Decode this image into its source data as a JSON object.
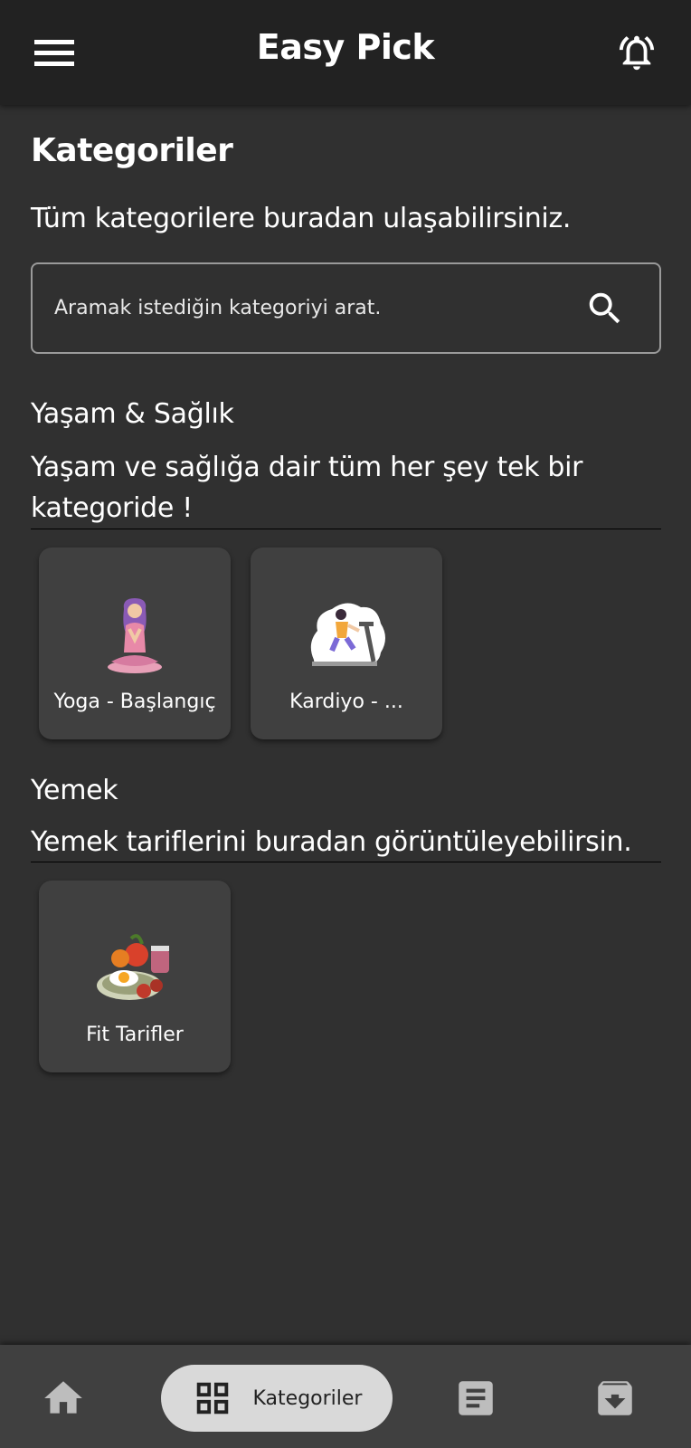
{
  "app_bar": {
    "title": "Easy Pick",
    "menu_icon": "hamburger-menu-icon",
    "bell_icon": "notification-bell-icon"
  },
  "page": {
    "title": "Kategoriler",
    "subtitle": "Tüm kategorilere buradan ulaşabilirsiniz."
  },
  "search": {
    "placeholder": "Aramak istediğin kategoriyi arat.",
    "value": "",
    "icon": "search-icon"
  },
  "sections": [
    {
      "title": "Yaşam & Sağlık",
      "description": "Yaşam ve sağlığa dair tüm her şey tek bir kategoride !",
      "cards": [
        {
          "label": "Yoga - Başlangıç",
          "icon": "yoga-illustration"
        },
        {
          "label": "Kardiyo - ...",
          "icon": "treadmill-illustration"
        }
      ]
    },
    {
      "title": "Yemek",
      "description": "Yemek tariflerini buradan görüntüleyebilirsin.",
      "cards": [
        {
          "label": "Fit Tarifler",
          "icon": "food-plate-illustration"
        }
      ]
    }
  ],
  "bottom_nav": {
    "items": [
      {
        "icon": "home-icon"
      },
      {
        "icon": "grid-icon",
        "label": "Kategoriler",
        "active": true
      },
      {
        "icon": "document-icon"
      },
      {
        "icon": "archive-icon"
      }
    ]
  },
  "colors": {
    "background": "#303030",
    "app_bar": "#222222",
    "card": "#404040",
    "nav_bar": "#404040",
    "nav_active_pill": "#d9d9d9"
  }
}
